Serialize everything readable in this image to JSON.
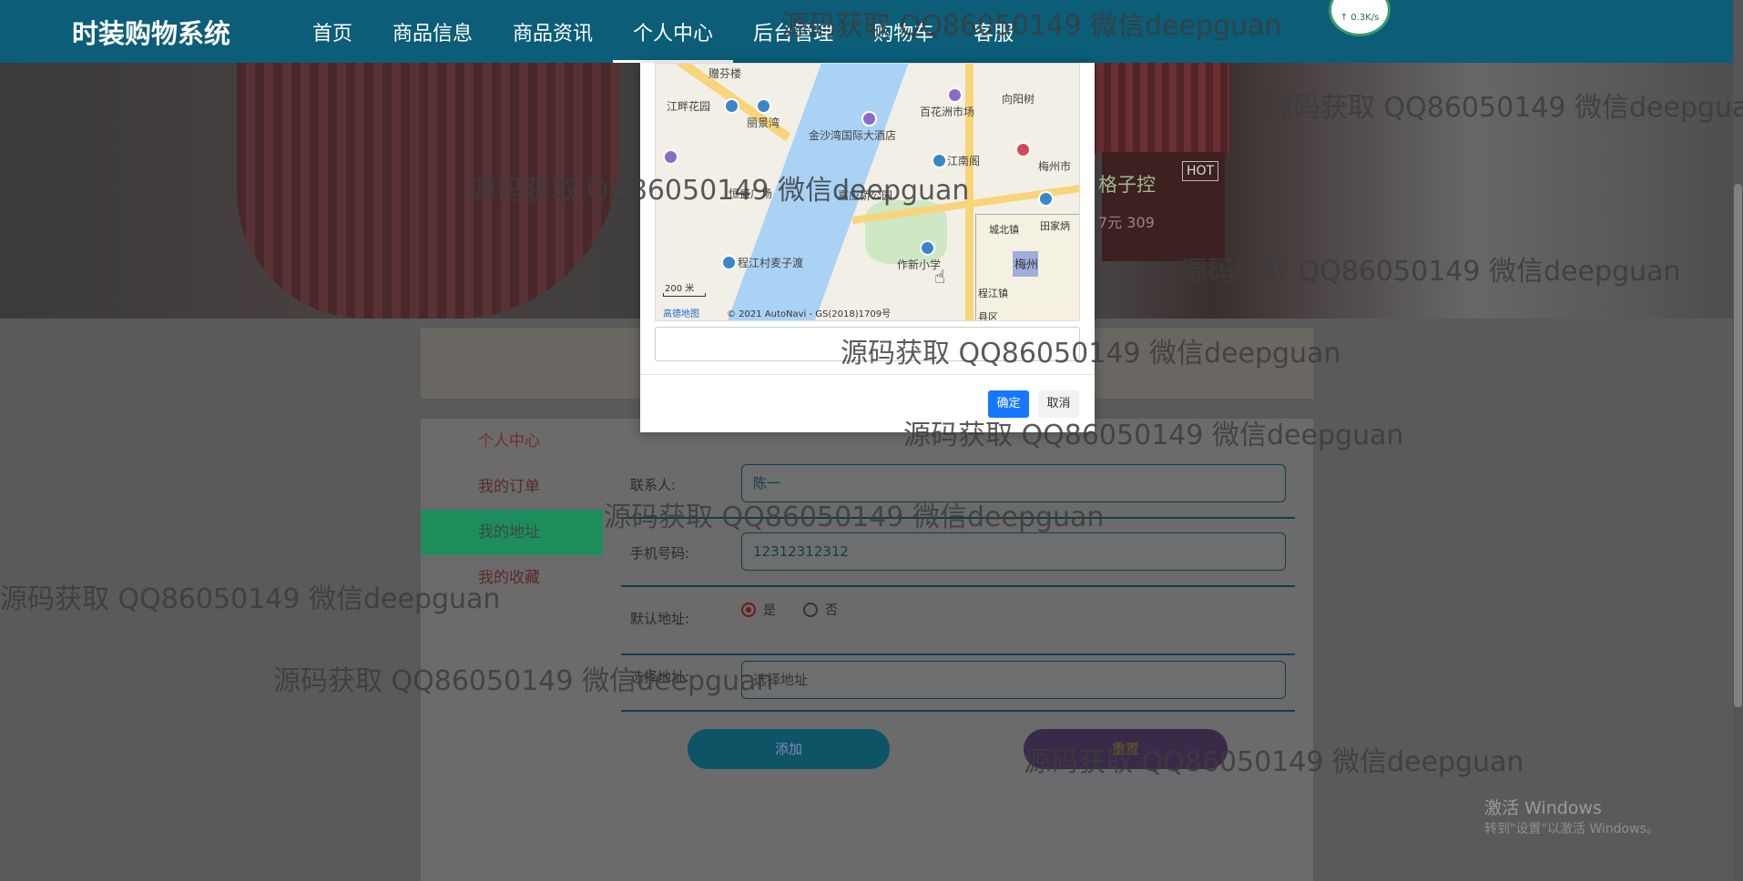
{
  "site": {
    "brand": "时装购物系统"
  },
  "nav": {
    "items": [
      "首页",
      "商品信息",
      "商品资讯",
      "个人中心",
      "后台管理",
      "购物车",
      "客服"
    ],
    "active_index": 3
  },
  "net_indicator": {
    "speed": "↑ 0.3K/s"
  },
  "hero": {
    "hot": "HOT",
    "partial_text": "格子控",
    "partial_price": "7元 309"
  },
  "side_menu": {
    "items": [
      "个人中心",
      "我的订单",
      "我的地址",
      "我的收藏"
    ],
    "active_index": 2
  },
  "form": {
    "contact_label": "联系人:",
    "contact_value": "陈一",
    "phone_label": "手机号码:",
    "phone_value": "12312312312",
    "default_label": "默认地址:",
    "radio_yes": "是",
    "radio_no": "否",
    "default_selected": "是",
    "address_label": "选择地址:",
    "address_placeholder": "选择地址",
    "add_button": "添加",
    "reset_button": "重置"
  },
  "modal": {
    "ok_button": "确定",
    "cancel_button": "取消",
    "map": {
      "labels": [
        "赠芬楼",
        "江畔花园",
        "丽景湾",
        "百花洲市场",
        "向阳树",
        "金沙湾国际大酒店",
        "江南阁",
        "梅州市",
        "恒盛广场",
        "嘉应桥公园",
        "程江村麦子渡",
        "作新小学",
        "城北镇",
        "田家炳",
        "梅州",
        "程江镇",
        "县区"
      ],
      "scale": "200 米",
      "logo": "高德地图",
      "copyright": "© 2021 AutoNavi - GS(2018)1709号"
    }
  },
  "watermark": {
    "text": "源码获取 QQ86050149 微信deepguan"
  },
  "windows_activation": {
    "title": "激活 Windows",
    "subtitle": "转到\"设置\"以激活 Windows。"
  }
}
